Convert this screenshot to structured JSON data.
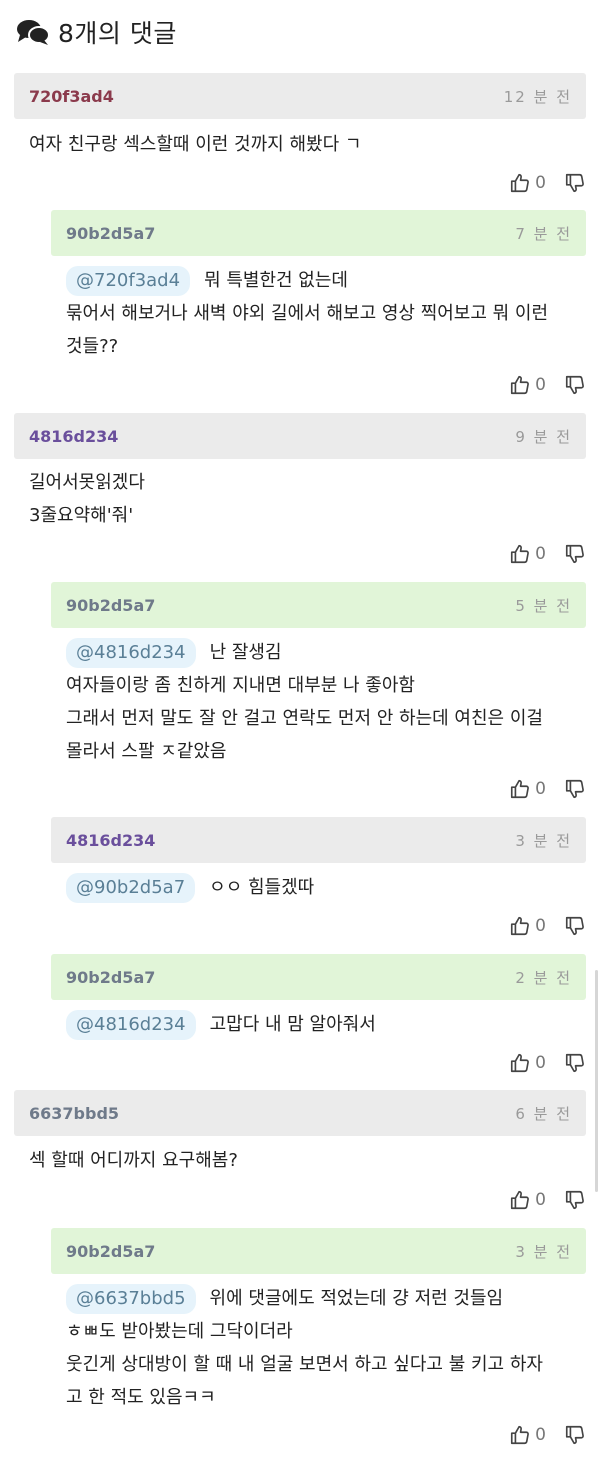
{
  "header": {
    "title": "8개의 댓글"
  },
  "comments": [
    {
      "author": "720f3ad4",
      "time": "12 분 전",
      "mention": "",
      "lines": [
        "여자 친구랑 섹스할때 이런 것까지 해봤다 ㄱ"
      ],
      "likes": "0"
    },
    {
      "author": "90b2d5a7",
      "time": "7 분 전",
      "mention": "@720f3ad4",
      "lines": [
        "뭐 특별한건 없는데",
        "묶어서 해보거나 새벽 야외 길에서 해보고 영상 찍어보고 뭐 이런",
        "것들??"
      ],
      "likes": "0"
    },
    {
      "author": "4816d234",
      "time": "9 분 전",
      "mention": "",
      "lines": [
        "길어서못읽겠다",
        "3줄요약해'줘'"
      ],
      "likes": "0"
    },
    {
      "author": "90b2d5a7",
      "time": "5 분 전",
      "mention": "@4816d234",
      "lines": [
        "난 잘생김",
        "여자들이랑 좀 친하게 지내면 대부분 나 좋아함",
        "그래서 먼저 말도 잘 안 걸고 연락도 먼저 안 하는데 여친은 이걸",
        "몰라서 스팔 ㅈ같았음"
      ],
      "likes": "0"
    },
    {
      "author": "4816d234",
      "time": "3 분 전",
      "mention": "@90b2d5a7",
      "lines": [
        "ㅇㅇ 힘들겠따"
      ],
      "likes": "0"
    },
    {
      "author": "90b2d5a7",
      "time": "2 분 전",
      "mention": "@4816d234",
      "lines": [
        "고맙다 내 맘 알아줘서"
      ],
      "likes": "0"
    },
    {
      "author": "6637bbd5",
      "time": "6 분 전",
      "mention": "",
      "lines": [
        "섹 할때 어디까지 요구해봄?"
      ],
      "likes": "0"
    },
    {
      "author": "90b2d5a7",
      "time": "3 분 전",
      "mention": "@6637bbd5",
      "lines": [
        "위에 댓글에도 적었는데 걍 저런 것들임",
        "ㅎㅃ도 받아봤는데 그닥이더라",
        "웃긴게 상대방이 할 때 내 얼굴 보면서 하고 싶다고 불 키고 하자",
        "고 한 적도 있음ㅋㅋ"
      ],
      "likes": "0"
    }
  ],
  "icons": {
    "header": "comments-icon",
    "like": "thumbs-up-icon",
    "dislike": "thumbs-down-icon"
  },
  "colors": {
    "header_gray": "#ebebeb",
    "header_green": "#e1f5d8",
    "mention_bg": "#e6f3fb"
  }
}
